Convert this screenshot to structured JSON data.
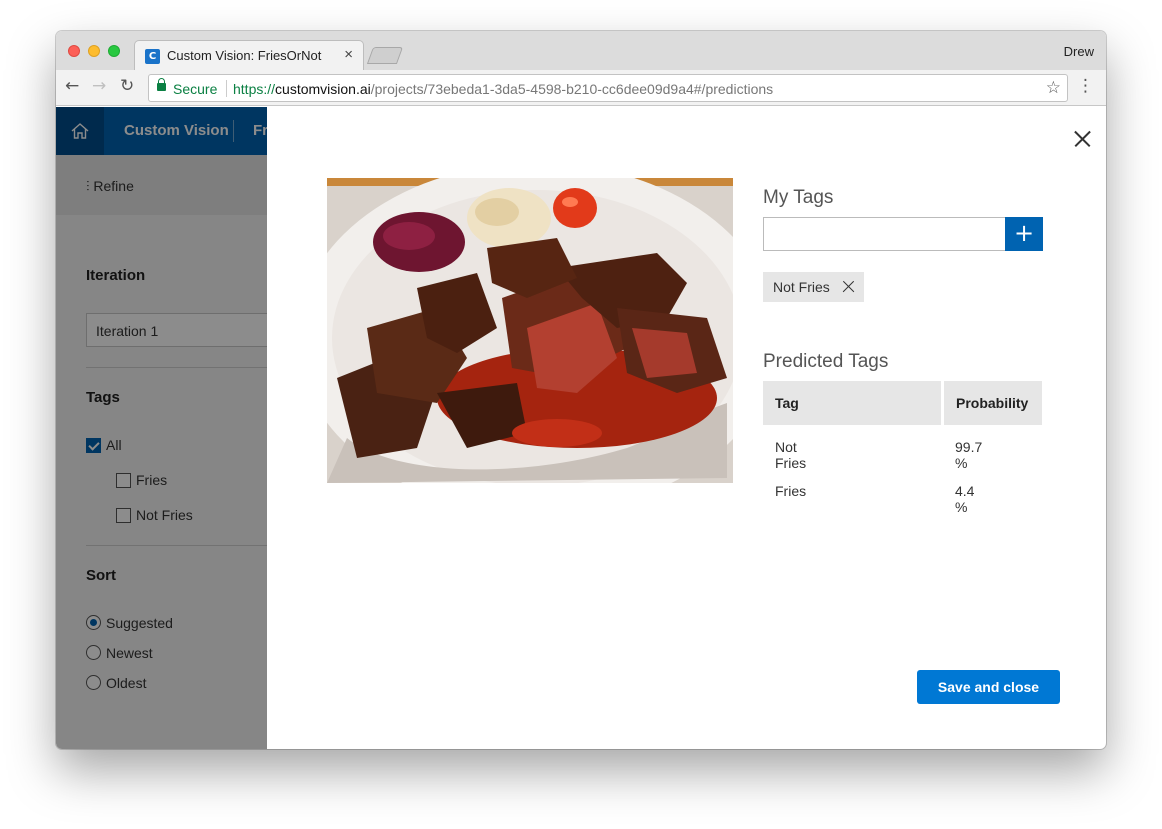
{
  "browser": {
    "tab_title": "Custom Vision: FriesOrNot",
    "tab_close": "×",
    "favicon_glyph": "C",
    "profile": "Drew",
    "secure_label": "Secure",
    "url_scheme": "https://",
    "url_domain": "customvision.ai",
    "url_path": "/projects/73ebeda1-3da5-4598-b210-cc6dee09d9a4#/predictions",
    "back_glyph": "←",
    "forward_glyph": "→",
    "reload_glyph": "↻",
    "star_glyph": "☆",
    "menu_glyph": "⋮"
  },
  "app": {
    "brand": "Custom Vision",
    "project_partial": "Fr",
    "accent_color": "#0063b1"
  },
  "sidebar": {
    "refine_label": "Refine",
    "iteration_heading": "Iteration",
    "iteration_selected": "Iteration 1",
    "tags_heading": "Tags",
    "tag_filters": [
      {
        "label": "All",
        "checked": true
      },
      {
        "label": "Fries",
        "checked": false
      },
      {
        "label": "Not Fries",
        "checked": false
      }
    ],
    "sort_heading": "Sort",
    "sort_options": [
      {
        "label": "Suggested",
        "selected": true
      },
      {
        "label": "Newest",
        "selected": false
      },
      {
        "label": "Oldest",
        "selected": false
      }
    ]
  },
  "modal": {
    "my_tags_title": "My Tags",
    "tag_input_value": "",
    "add_glyph": "+",
    "applied_tags": [
      "Not Fries"
    ],
    "predicted_title": "Predicted Tags",
    "predicted_columns": [
      "Tag",
      "Probability"
    ],
    "predicted_rows": [
      {
        "tag": "Not Fries",
        "probability": "99.7 %"
      },
      {
        "tag": "Fries",
        "probability": "4.4 %"
      }
    ],
    "save_label": "Save and close"
  }
}
